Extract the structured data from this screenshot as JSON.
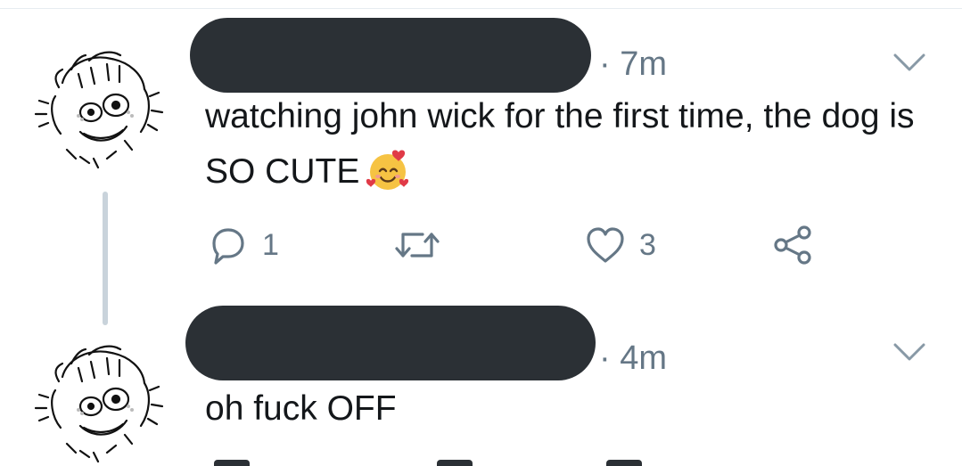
{
  "tweets": [
    {
      "timestamp": "· 7m",
      "text": "watching john wick for the first time, the dog is SO CUTE",
      "emoji": "smiling-face-with-hearts",
      "actions": {
        "reply_count": "1",
        "retweet_count": "",
        "like_count": "3"
      }
    },
    {
      "timestamp": "· 4m",
      "text": "oh fuck OFF"
    }
  ],
  "colors": {
    "text": "#14171a",
    "muted": "#657786",
    "redaction": "#2b3035",
    "thread_line": "#c9d3db"
  },
  "icons": [
    "reply-icon",
    "retweet-icon",
    "like-icon",
    "share-icon",
    "chevron-down-icon"
  ]
}
